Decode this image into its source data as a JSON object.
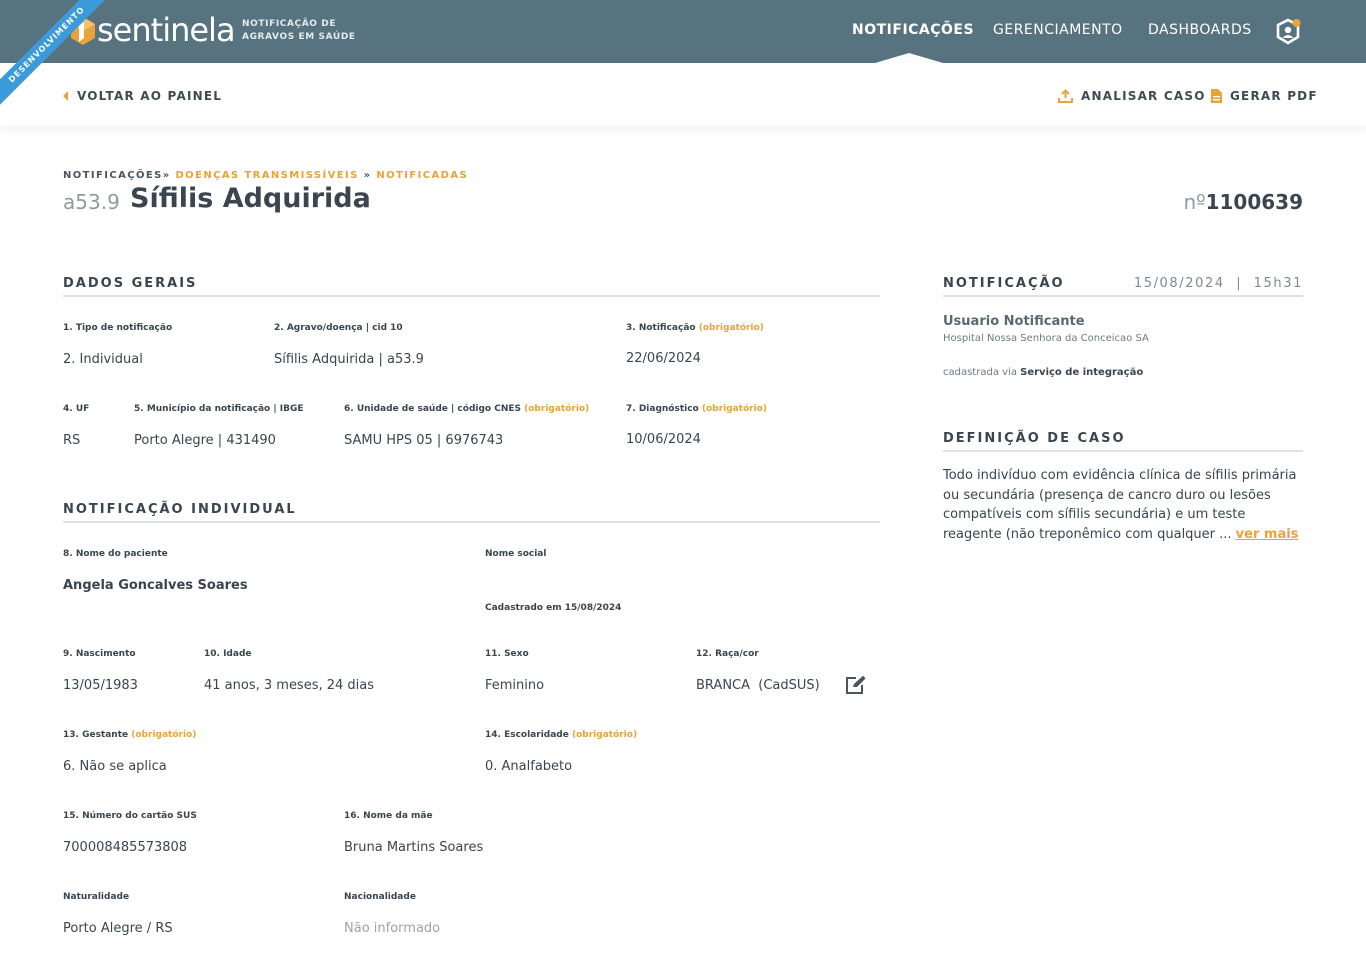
{
  "header": {
    "ribbon": "DESENVOLVIMENTO",
    "logo_text": "sentinela",
    "logo_sub": "NOTIFICAÇÃO DE AGRAVOS EM SAÚDE",
    "nav": [
      "NOTIFICAÇÕES",
      "GERENCIAMENTO",
      "DASHBOARDS"
    ],
    "active_nav": "NOTIFICAÇÕES",
    "user_icon": "user-shield-icon",
    "colors": {
      "bar": "#56737f",
      "accent": "#e8a33a",
      "ribbon": "#3b9ad9"
    }
  },
  "subbar": {
    "back": "VOLTAR AO PAINEL",
    "analyze": "ANALISAR CASO",
    "pdf": "GERAR PDF"
  },
  "breadcrumb": {
    "root": "NOTIFICAÇÕES",
    "sep1": "»",
    "level2": "DOENÇAS TRANSMISSÍVEIS",
    "sep2": "»",
    "level3": "NOTIFICADAS"
  },
  "case": {
    "code": "a53.9",
    "title": "Sífilis Adquirida",
    "number_prefix": "nº",
    "number": "1100639"
  },
  "dados_gerais": {
    "heading": "DADOS GERAIS",
    "tipo_label": "1. Tipo de notificação",
    "tipo_value": "2. Individual",
    "agravo_label": "2. Agravo/doença | cid 10",
    "agravo_value": "Sífilis Adquirida | a53.9",
    "notif_label": "3. Notificação",
    "notif_req": "(obrigatório)",
    "notif_value": "22/06/2024",
    "uf_label": "4. UF",
    "uf_value": "RS",
    "mun_label": "5. Município da notificação | IBGE",
    "mun_value": "Porto Alegre | 431490",
    "unid_label": "6. Unidade de saúde | código CNES",
    "unid_req": "(obrigatório)",
    "unid_value": "SAMU HPS 05 | 6976743",
    "diag_label": "7. Diagnóstico",
    "diag_req": "(obrigatório)",
    "diag_value": "10/06/2024"
  },
  "individual": {
    "heading": "NOTIFICAÇÃO INDIVIDUAL",
    "nome_label": "8. Nome do paciente",
    "nome_value": "Angela Goncalves Soares",
    "social_label": "Nome social",
    "cadastrado": "Cadastrado em 15/08/2024",
    "nasc_label": "9. Nascimento",
    "nasc_value": "13/05/1983",
    "idade_label": "10. Idade",
    "idade_value": "41 anos, 3 meses, 24 dias",
    "sexo_label": "11. Sexo",
    "sexo_value": "Feminino",
    "raca_label": "12. Raça/cor",
    "raca_value": "BRANCA  (CadSUS)",
    "gest_label": "13. Gestante",
    "gest_req": "(obrigatório)",
    "gest_value": "6. Não se aplica",
    "esc_label": "14. Escolaridade",
    "esc_req": "(obrigatório)",
    "esc_value": "0. Analfabeto",
    "sus_label": "15. Número do cartão SUS",
    "sus_value": "700008485573808",
    "mae_label": "16. Nome da mãe",
    "mae_value": "Bruna Martins Soares",
    "nat_label": "Naturalidade",
    "nat_value": "Porto Alegre / RS",
    "nac_label": "Nacionalidade",
    "nac_value": "Não informado"
  },
  "sidebar": {
    "notif_heading": "NOTIFICAÇÃO",
    "date": "15/08/2024  |  15h31",
    "user": "Usuario Notificante",
    "hospital": "Hospital Nossa Senhora da Conceicao SA",
    "via_prefix": "cadastrada via ",
    "via_value": "Serviço de integração",
    "def_heading": "DEFINIÇÃO DE CASO",
    "def_text": "Todo indivíduo com evidência clínica de sífilis primária ou secundária (presença de cancro duro ou lesões compatíveis com sífilis secundária) e um teste reagente (não treponêmico com qualquer ... ",
    "ver_mais": "ver mais"
  }
}
